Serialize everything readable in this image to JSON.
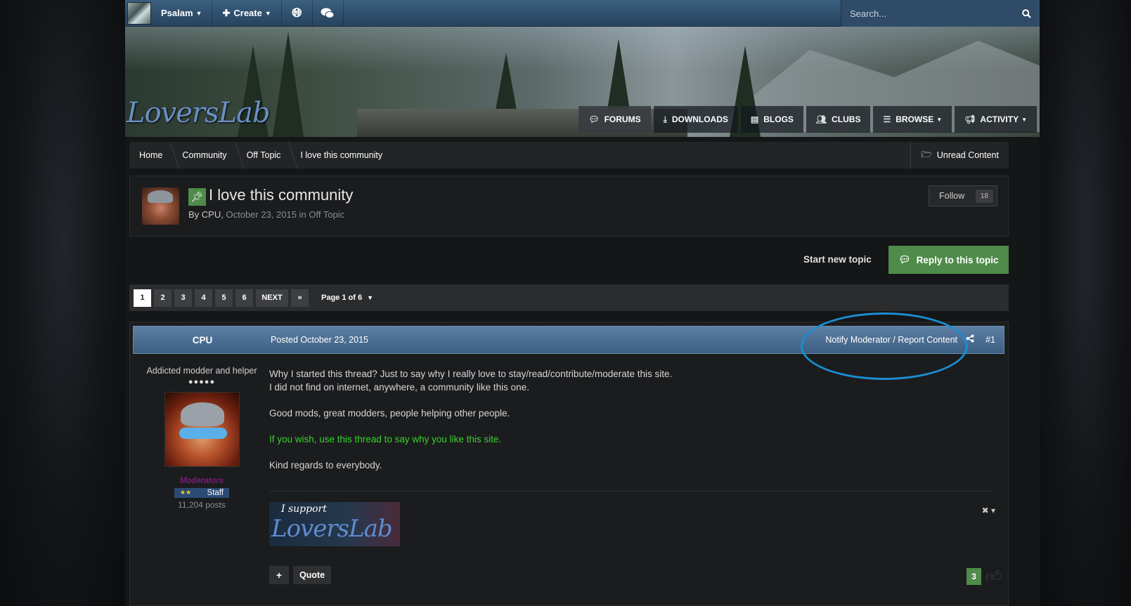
{
  "topbar": {
    "user": "Psalam",
    "create": "Create",
    "search_placeholder": "Search..."
  },
  "brand": {
    "logo_text": "LoversLab"
  },
  "main_nav": [
    {
      "label": "FORUMS",
      "icon": "chat-bubble-icon"
    },
    {
      "label": "DOWNLOADS",
      "icon": "download-icon"
    },
    {
      "label": "BLOGS",
      "icon": "book-icon"
    },
    {
      "label": "CLUBS",
      "icon": "users-icon"
    },
    {
      "label": "BROWSE",
      "icon": "list-icon"
    },
    {
      "label": "ACTIVITY",
      "icon": "megaphone-icon"
    }
  ],
  "breadcrumb": [
    "Home",
    "Community",
    "Off Topic",
    "I love this community"
  ],
  "unread_content": "Unread Content",
  "topic": {
    "title": "I love this community",
    "by_label": "By",
    "author": "CPU",
    "date": "October 23, 2015",
    "in_label": "in",
    "forum": "Off Topic",
    "follow_label": "Follow",
    "follow_count": "18"
  },
  "actions": {
    "start_new": "Start new topic",
    "reply": "Reply to this topic"
  },
  "pagination": {
    "pages": [
      "1",
      "2",
      "3",
      "4",
      "5",
      "6"
    ],
    "current": "1",
    "next": "NEXT",
    "last": "»",
    "page_of": "Page 1 of 6"
  },
  "post": {
    "author": "CPU",
    "posted": "Posted October 23, 2015",
    "report": "Notify Moderator / Report Content",
    "number": "#1",
    "author_title": "Addicted modder and helper",
    "pips": "●●●●●",
    "group": "Moderators",
    "badge_stars": "★★",
    "badge_label": "Staff",
    "post_count": "11,204 posts",
    "lines": [
      "Why I started this thread? Just to say why I really love to stay/read/contribute/moderate this site.",
      "I did not find on internet, anywhere, a community like this one.",
      "Good mods, great modders, people helping other people.",
      "If you wish, use this thread to say why you like this site.",
      "Kind regards to everybody."
    ],
    "signature_line1": "I support",
    "signature_line2": "LoversLab",
    "quote_label": "Quote",
    "plus_label": "+",
    "reputation": "3"
  },
  "colors": {
    "accent_green": "#4f8b4a",
    "header_blue": "#3c5e83",
    "highlight_circle": "#1a8dd1",
    "green_text": "#37d32c",
    "moderator_purple": "#7a1c7a"
  }
}
